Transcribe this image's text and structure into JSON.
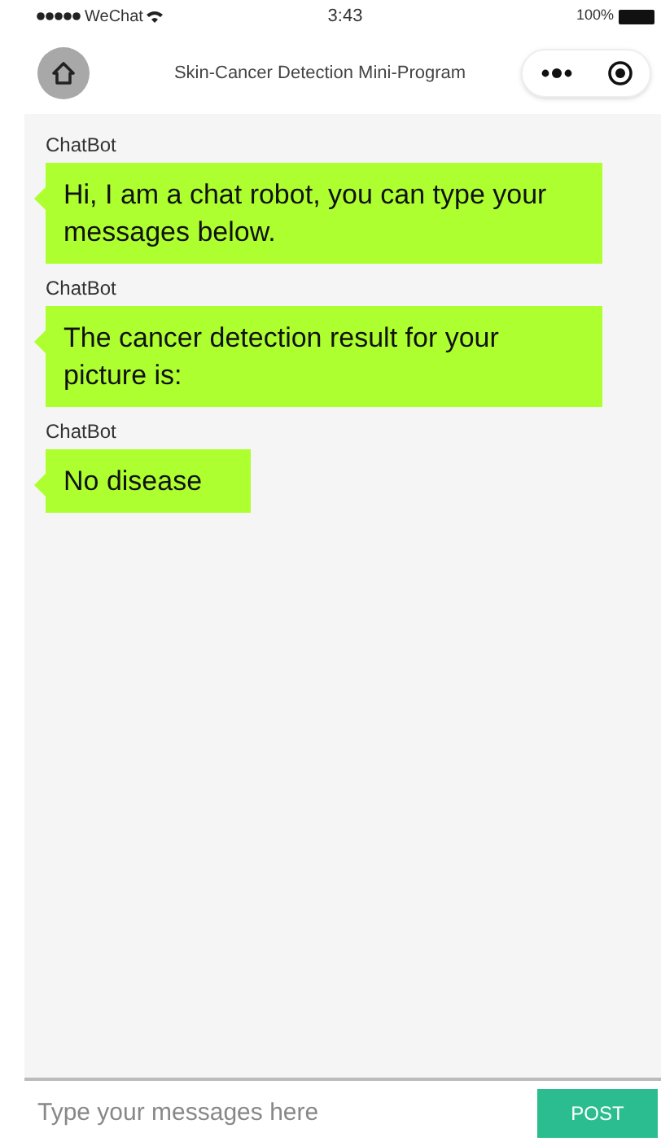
{
  "status_bar": {
    "carrier": "WeChat",
    "time": "3:43",
    "battery": "100%"
  },
  "nav": {
    "title": "Skin-Cancer Detection Mini-Program"
  },
  "messages": [
    {
      "sender": "ChatBot",
      "text": "Hi, I am a chat robot, you can type your messages below."
    },
    {
      "sender": "ChatBot",
      "text": "The cancer detection result for your picture is:"
    },
    {
      "sender": "ChatBot",
      "text": "No disease"
    }
  ],
  "composer": {
    "placeholder": "Type your messages here",
    "button": "POST"
  }
}
